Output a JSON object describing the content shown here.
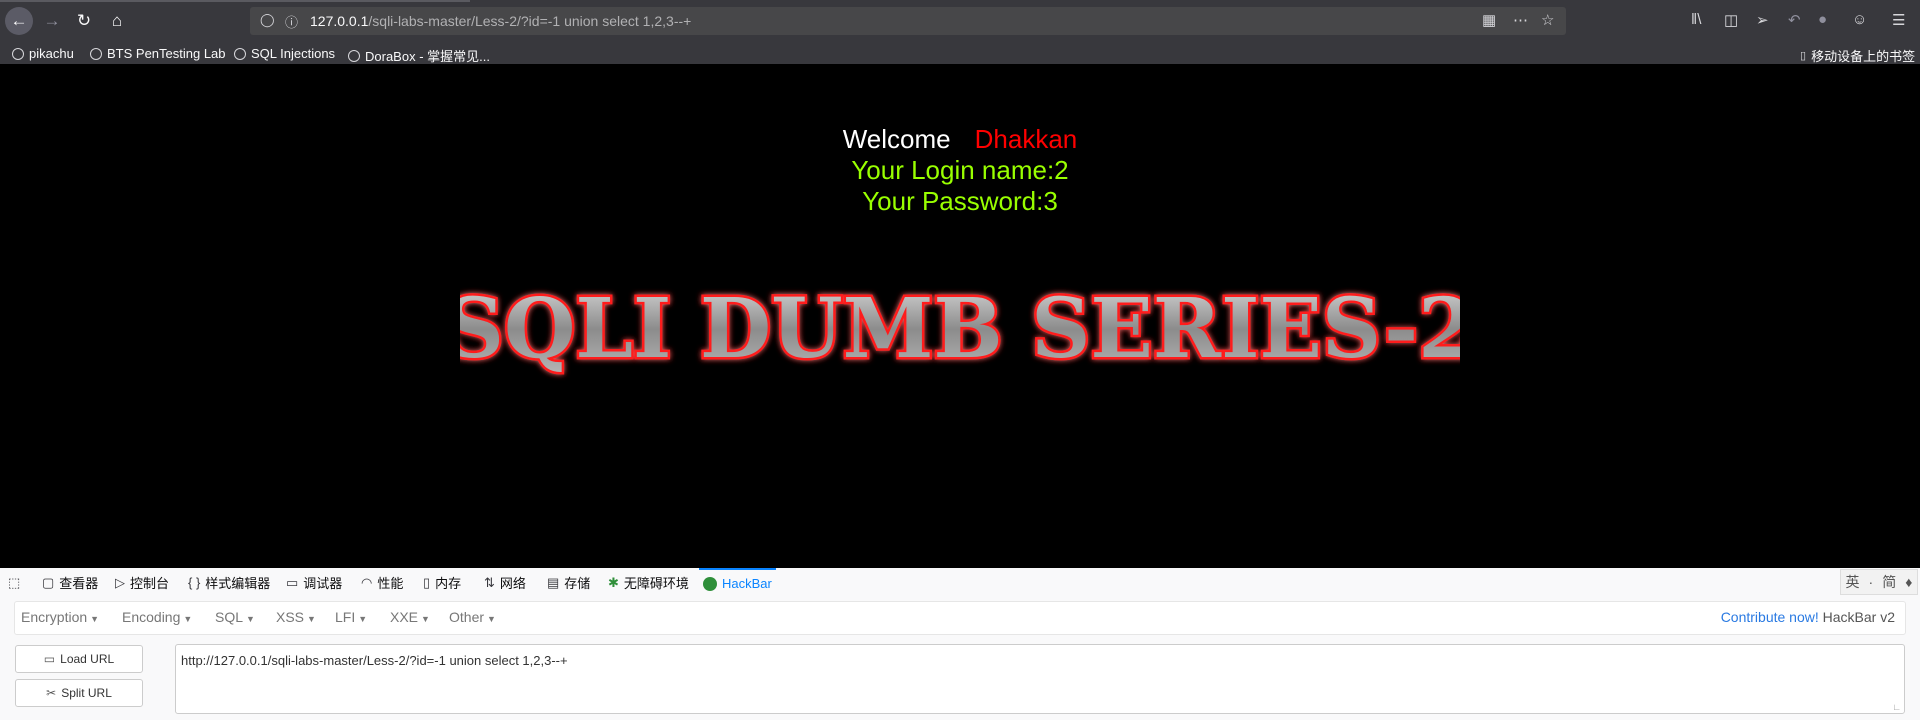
{
  "browser": {
    "url_host": "127.0.0.1",
    "url_path": "/sqli-labs-master/Less-2/?id=-1 union select 1,2,3--+",
    "bookmarks": [
      {
        "label": "pikachu"
      },
      {
        "label": "BTS PenTesting Lab"
      },
      {
        "label": "SQL Injections"
      },
      {
        "label": "DoraBox - 掌握常见..."
      }
    ],
    "mobile_bookmarks": "移动设备上的书签"
  },
  "page": {
    "welcome": "Welcome",
    "user": "Dhakkan",
    "login_line": "Your Login name:2",
    "password_line": "Your Password:3",
    "logo_text": "SQLI DUMB SERIES-2"
  },
  "devtools": {
    "tabs": [
      {
        "label": "查看器"
      },
      {
        "label": "控制台"
      },
      {
        "label": "样式编辑器"
      },
      {
        "label": "调试器"
      },
      {
        "label": "性能"
      },
      {
        "label": "内存"
      },
      {
        "label": "网络"
      },
      {
        "label": "存储"
      },
      {
        "label": "无障碍环境"
      },
      {
        "label": "HackBar"
      }
    ],
    "ime": {
      "a": "英",
      "b": "·",
      "c": "简"
    }
  },
  "hackbar": {
    "menu": [
      {
        "label": "Encryption"
      },
      {
        "label": "Encoding"
      },
      {
        "label": "SQL"
      },
      {
        "label": "XSS"
      },
      {
        "label": "LFI"
      },
      {
        "label": "XXE"
      },
      {
        "label": "Other"
      }
    ],
    "contribute": "Contribute now!",
    "version": "HackBar v2",
    "load_url": "Load URL",
    "split_url": "Split URL",
    "url_value": "http://127.0.0.1/sqli-labs-master/Less-2/?id=-1 union select 1,2,3--+"
  },
  "colors": {
    "page_bg": "#000000",
    "user": "#ff0000",
    "green_text": "#99ff00",
    "chrome": "#38383d",
    "hackbar_accent": "#0a84ff"
  }
}
